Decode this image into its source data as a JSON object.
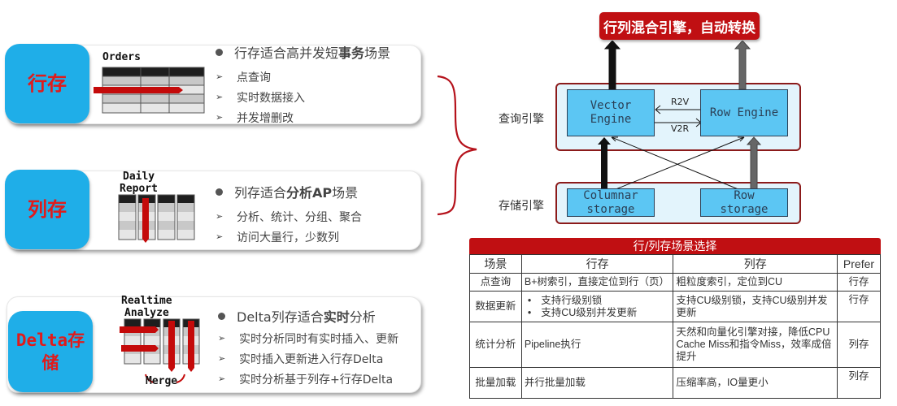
{
  "row_store": {
    "tag": "行存",
    "table_label": "Orders",
    "headline_prefix": "行存适合高并发短",
    "headline_bold": "事务",
    "headline_suffix": "场景",
    "points": [
      "点查询",
      "实时数据接入",
      "并发增删改"
    ]
  },
  "col_store": {
    "tag": "列存",
    "table_label_line1": "Daily",
    "table_label_line2": "Report",
    "headline_prefix": "列存适合",
    "headline_bold": "分析AP",
    "headline_suffix": "场景",
    "points": [
      "分析、统计、分组、聚合",
      "访问大量行，少数列"
    ]
  },
  "delta_store": {
    "tag_line1": "Delta存",
    "tag_line2": "储",
    "table_label_line1": "Realtime",
    "table_label_line2": "Analyze",
    "merge_label": "Merge",
    "headline_prefix": "Delta列存适合",
    "headline_bold": "实时",
    "headline_suffix": "分析",
    "points": [
      "实时分析同时有实时插入、更新",
      "实时插入更新进入行存Delta",
      "实时分析基于列存+行存Delta"
    ]
  },
  "diagram": {
    "banner": "行列混合引擎，自动转换",
    "query_layer_label": "查询引擎",
    "storage_layer_label": "存储引擎",
    "vector_engine_line1": "Vector",
    "vector_engine_line2": "Engine",
    "row_engine": "Row Engine",
    "r2v": "R2V",
    "v2r": "V2R",
    "columnar_storage_line1": "Columnar",
    "columnar_storage_line2": "storage",
    "row_storage_line1": "Row",
    "row_storage_line2": "storage"
  },
  "comparison": {
    "title": "行/列存场景选择",
    "headers": [
      "场景",
      "行存",
      "列存",
      "Prefer"
    ],
    "rows": [
      {
        "scene": "点查询",
        "row": "B+树索引，直接定位到行（页）",
        "col": "粗粒度索引，定位到CU",
        "prefer": "行存"
      },
      {
        "scene": "数据更新",
        "row_items": [
          "支持行级别锁",
          "支持CU级别并发更新"
        ],
        "col": "支持CU级别锁，支持CU级别并发更新",
        "prefer": "行存"
      },
      {
        "scene": "统计分析",
        "row": "Pipeline执行",
        "col": "天然和向量化引擎对接，降低CPU Cache Miss和指令Miss，效率成倍提升",
        "prefer": "列存"
      },
      {
        "scene": "批量加载",
        "row": "并行批量加载",
        "col": "压缩率高，IO量更小",
        "prefer": "列存"
      }
    ]
  },
  "colors": {
    "accent_red": "#c00f12",
    "tag_blue": "#1faee8",
    "engine_blue": "#5cc6f3",
    "layer_bg": "#e3f4fc"
  }
}
